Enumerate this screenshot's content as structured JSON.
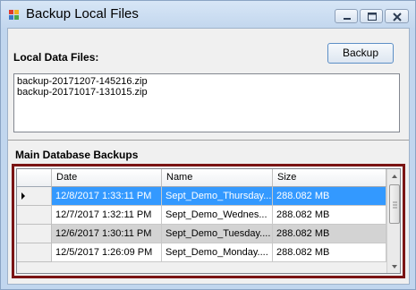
{
  "window": {
    "title": "Backup Local Files"
  },
  "local": {
    "label": "Local Data Files:",
    "backup_button": "Backup",
    "files": [
      "backup-20171207-145216.zip",
      "backup-20171017-131015.zip"
    ]
  },
  "main": {
    "label": "Main Database Backups",
    "columns": [
      "Date",
      "Name",
      "Size"
    ],
    "rows": [
      {
        "date": "12/8/2017 1:33:11 PM",
        "name": "Sept_Demo_Thursday....",
        "size": "288.082 MB"
      },
      {
        "date": "12/7/2017 1:32:11 PM",
        "name": "Sept_Demo_Wednes...",
        "size": "288.082 MB"
      },
      {
        "date": "12/6/2017 1:30:11 PM",
        "name": "Sept_Demo_Tuesday....",
        "size": "288.082 MB"
      },
      {
        "date": "12/5/2017 1:26:09 PM",
        "name": "Sept_Demo_Monday....",
        "size": "288.082 MB"
      }
    ]
  },
  "colors": {
    "selection": "#3399ff",
    "highlight_border": "#7a1414"
  },
  "icons": {
    "app": "app-icon",
    "minimize": "minimize-icon",
    "maximize": "maximize-icon",
    "close": "close-icon",
    "row_pointer": "row-pointer-icon"
  }
}
